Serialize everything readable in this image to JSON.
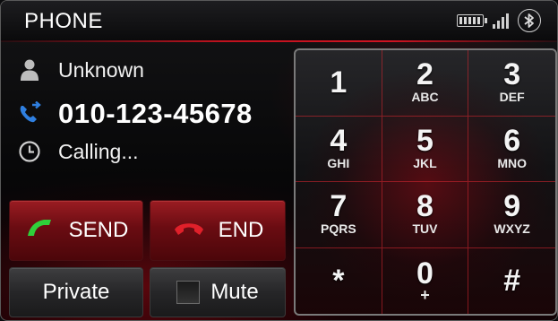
{
  "header": {
    "title": "PHONE"
  },
  "status_icons": [
    "battery-icon",
    "signal-icon",
    "bluetooth-icon"
  ],
  "call": {
    "contact_name": "Unknown",
    "number": "010-123-45678",
    "status": "Calling..."
  },
  "buttons": {
    "send": "SEND",
    "end": "END",
    "private": "Private",
    "mute": "Mute"
  },
  "keypad": [
    {
      "digit": "1",
      "letters": ""
    },
    {
      "digit": "2",
      "letters": "ABC"
    },
    {
      "digit": "3",
      "letters": "DEF"
    },
    {
      "digit": "4",
      "letters": "GHI"
    },
    {
      "digit": "5",
      "letters": "JKL"
    },
    {
      "digit": "6",
      "letters": "MNO"
    },
    {
      "digit": "7",
      "letters": "PQRS"
    },
    {
      "digit": "8",
      "letters": "TUV"
    },
    {
      "digit": "9",
      "letters": "WXYZ"
    },
    {
      "digit": "*",
      "letters": ""
    },
    {
      "digit": "0",
      "letters": "+"
    },
    {
      "digit": "#",
      "letters": ""
    }
  ],
  "colors": {
    "accent_red": "#c0121e",
    "send_green": "#2fd03a",
    "end_red": "#e0202a",
    "number_icon_blue": "#2f7fe0"
  }
}
